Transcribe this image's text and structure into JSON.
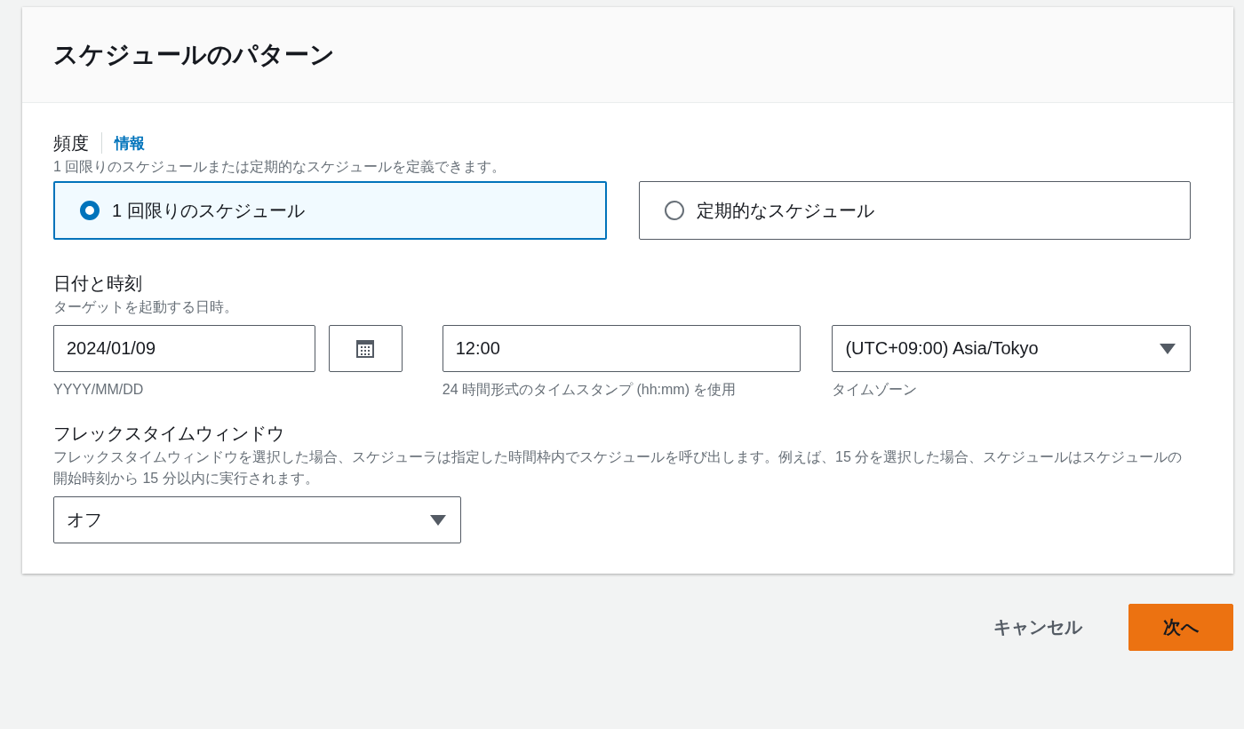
{
  "panel": {
    "title": "スケジュールのパターン"
  },
  "frequency": {
    "label": "頻度",
    "info_link": "情報",
    "description": "1 回限りのスケジュールまたは定期的なスケジュールを定義できます。",
    "options": [
      {
        "label": "1 回限りのスケジュール",
        "selected": true
      },
      {
        "label": "定期的なスケジュール",
        "selected": false
      }
    ]
  },
  "date_time": {
    "label": "日付と時刻",
    "description": "ターゲットを起動する日時。",
    "date": {
      "value": "2024/01/09",
      "hint": "YYYY/MM/DD"
    },
    "time": {
      "value": "12:00",
      "hint": "24 時間形式のタイムスタンプ (hh:mm) を使用"
    },
    "timezone": {
      "value": "(UTC+09:00) Asia/Tokyo",
      "hint": "タイムゾーン"
    }
  },
  "flex_window": {
    "label": "フレックスタイムウィンドウ",
    "description": "フレックスタイムウィンドウを選択した場合、スケジューラは指定した時間枠内でスケジュールを呼び出します。例えば、15 分を選択した場合、スケジュールはスケジュールの開始時刻から 15 分以内に実行されます。",
    "value": "オフ"
  },
  "buttons": [
    {
      "label": "キャンセル",
      "kind": "link"
    },
    {
      "label": "次へ",
      "kind": "primary"
    }
  ]
}
